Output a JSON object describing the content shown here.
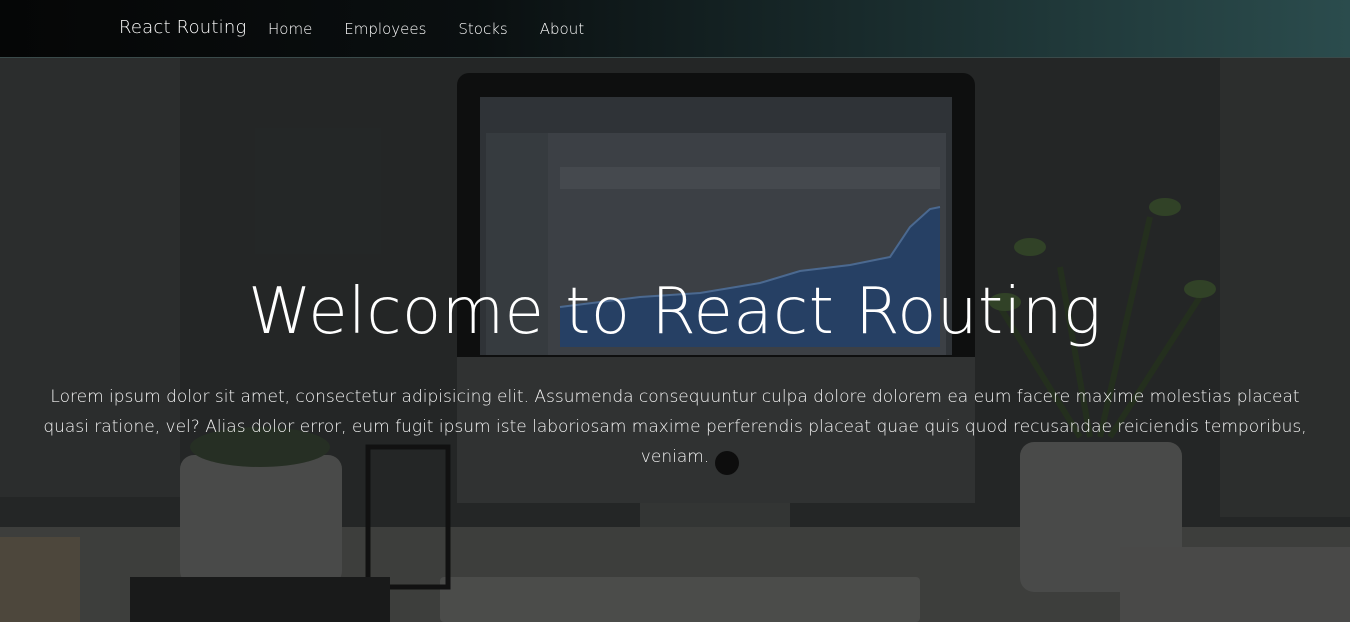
{
  "navbar": {
    "brand": "React Routing",
    "links": [
      "Home",
      "Employees",
      "Stocks",
      "About"
    ]
  },
  "hero": {
    "title": "Welcome to React Routing",
    "text": "Lorem ipsum dolor sit amet, consectetur adipisicing elit. Assumenda consequuntur culpa dolore dolorem ea eum facere maxime molestias placeat quasi ratione, vel? Alias dolor error, eum fugit ipsum iste laboriosam maxime perferendis placeat quae quis quod recusandae reiciendis temporibus, veniam.",
    "background_description_icon": "desk-workspace-photo"
  },
  "colors": {
    "navbar_start": "#050606",
    "navbar_end": "#2b4c4d",
    "text": "#ffffff"
  }
}
